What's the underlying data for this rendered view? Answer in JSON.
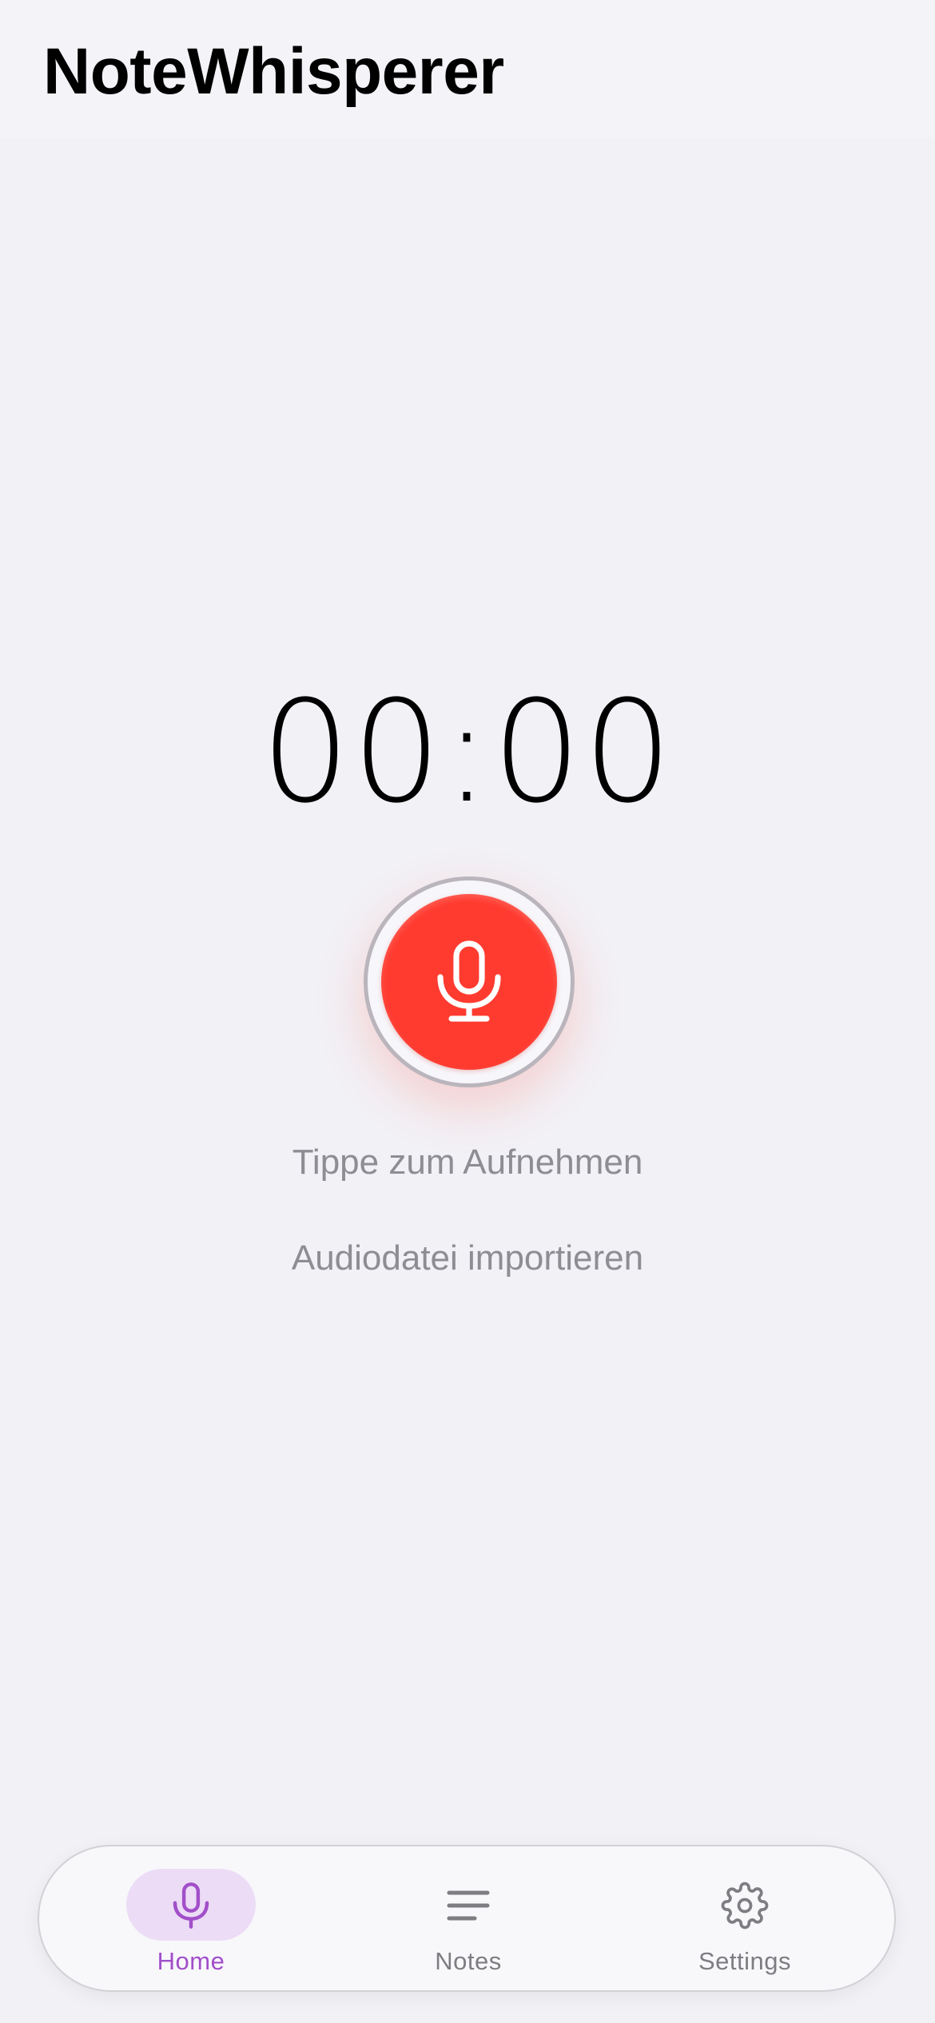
{
  "app": {
    "title": "NoteWhisperer"
  },
  "recorder": {
    "timer": "00:00",
    "record_icon": "microphone-icon",
    "hint": "Tippe zum Aufnehmen",
    "import_label": "Audiodatei importieren"
  },
  "tabbar": {
    "tabs": [
      {
        "label": "Home",
        "icon": "microphone-icon",
        "active": true
      },
      {
        "label": "Notes",
        "icon": "notes-lines-icon",
        "active": false
      },
      {
        "label": "Settings",
        "icon": "gear-icon",
        "active": false
      }
    ]
  },
  "colors": {
    "background": "#f2f1f6",
    "record_red": "#ff3b30",
    "accent_purple": "#a24fc9",
    "accent_pill": "#ecdcf6",
    "muted_text": "#8e8d93"
  }
}
